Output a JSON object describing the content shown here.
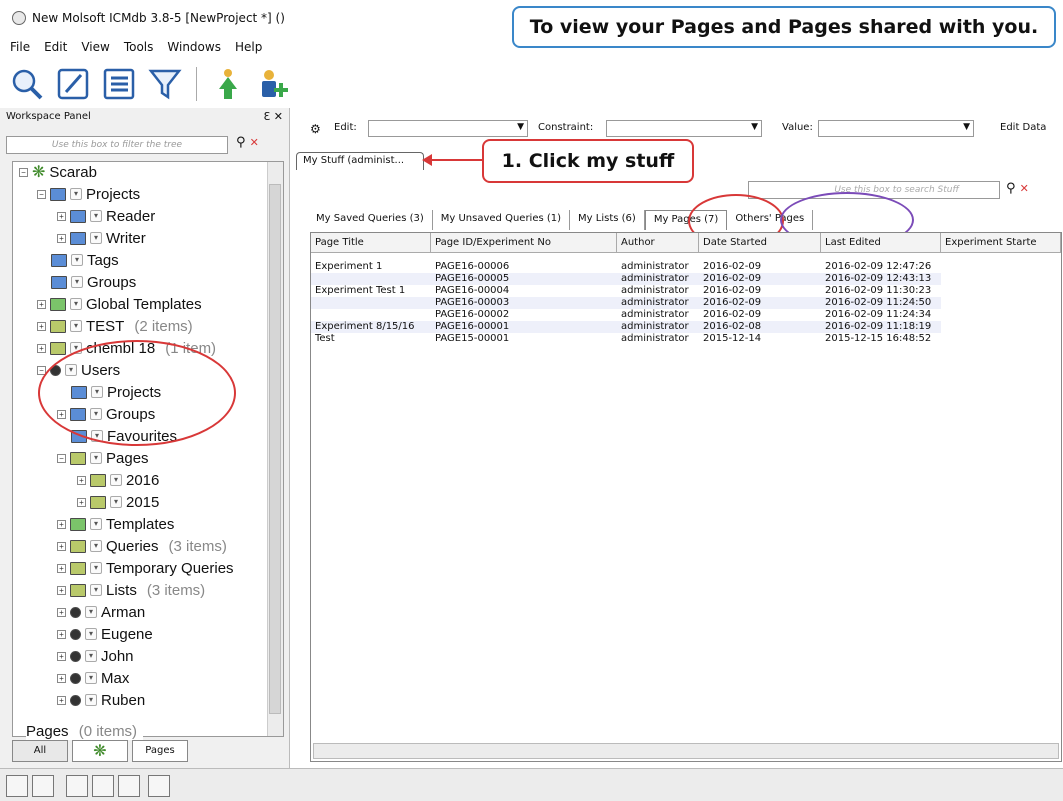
{
  "window": {
    "title": "New Molsoft ICMdb 3.8-5  [NewProject *] ()"
  },
  "menu": [
    "File",
    "Edit",
    "View",
    "Tools",
    "Windows",
    "Help"
  ],
  "toolbar": [
    "search-icon",
    "edit-icon",
    "list-icon",
    "filter-icon",
    "upload-icon",
    "add-user-icon"
  ],
  "callouts": {
    "top": "To view your Pages and Pages shared with you.",
    "click": "1. Click my stuff"
  },
  "workspace": {
    "header": "Workspace Panel",
    "header_icons": "Ɛ ✕",
    "filter_placeholder": "Use this box to filter the tree",
    "tree": [
      {
        "label": "Scarab",
        "count": ""
      },
      {
        "label": "Projects",
        "count": ""
      },
      {
        "label": "Reader",
        "count": ""
      },
      {
        "label": "Writer",
        "count": ""
      },
      {
        "label": "Tags",
        "count": ""
      },
      {
        "label": "Groups",
        "count": ""
      },
      {
        "label": "Global Templates",
        "count": ""
      },
      {
        "label": "TEST",
        "count": "(2 items)"
      },
      {
        "label": "chembl 18",
        "count": "(1 item)"
      },
      {
        "label": "Users",
        "count": ""
      },
      {
        "label": "Projects",
        "count": ""
      },
      {
        "label": "Groups",
        "count": ""
      },
      {
        "label": "Favourites",
        "count": ""
      },
      {
        "label": "Pages",
        "count": ""
      },
      {
        "label": "2016",
        "count": ""
      },
      {
        "label": "2015",
        "count": ""
      },
      {
        "label": "Templates",
        "count": ""
      },
      {
        "label": "Queries",
        "count": "(3 items)"
      },
      {
        "label": "Temporary Queries",
        "count": ""
      },
      {
        "label": "Lists",
        "count": "(3 items)"
      },
      {
        "label": "Arman",
        "count": ""
      },
      {
        "label": "Eugene",
        "count": ""
      },
      {
        "label": "John",
        "count": ""
      },
      {
        "label": "Max",
        "count": ""
      },
      {
        "label": "Ruben",
        "count": ""
      }
    ],
    "pages_row": {
      "label": "Pages",
      "count": "(0 items)"
    },
    "tabs": [
      "All",
      "",
      "Pages"
    ]
  },
  "editbar": {
    "edit_label": "Edit:",
    "constraint_label": "Constraint:",
    "value_label": "Value:",
    "edit_data_label": "Edit Data"
  },
  "mystuff_tab": "My Stuff (administ...",
  "stuff_search_placeholder": "Use this box to search Stuff",
  "subtabs": [
    "My Saved Queries (3)",
    "My Unsaved Queries (1)",
    "My Lists (6)",
    "My Pages (7)",
    "Others' Pages"
  ],
  "table": {
    "columns": [
      "Page Title",
      "Page ID/Experiment No",
      "Author",
      "Date Started",
      "Last Edited",
      "Experiment Starte"
    ],
    "rows": [
      [
        "Experiment 1",
        "PAGE16-00006",
        "administrator",
        "2016-02-09",
        "2016-02-09 12:47:26",
        ""
      ],
      [
        "",
        "PAGE16-00005",
        "administrator",
        "2016-02-09",
        "2016-02-09 12:43:13",
        ""
      ],
      [
        "Experiment Test 1",
        "PAGE16-00004",
        "administrator",
        "2016-02-09",
        "2016-02-09 11:30:23",
        ""
      ],
      [
        "",
        "PAGE16-00003",
        "administrator",
        "2016-02-09",
        "2016-02-09 11:24:50",
        ""
      ],
      [
        "",
        "PAGE16-00002",
        "administrator",
        "2016-02-09",
        "2016-02-09 11:24:34",
        ""
      ],
      [
        "Experiment 8/15/16",
        "PAGE16-00001",
        "administrator",
        "2016-02-08",
        "2016-02-09 11:18:19",
        ""
      ],
      [
        "Test",
        "PAGE15-00001",
        "administrator",
        "2015-12-14",
        "2015-12-15 16:48:52",
        ""
      ]
    ]
  }
}
